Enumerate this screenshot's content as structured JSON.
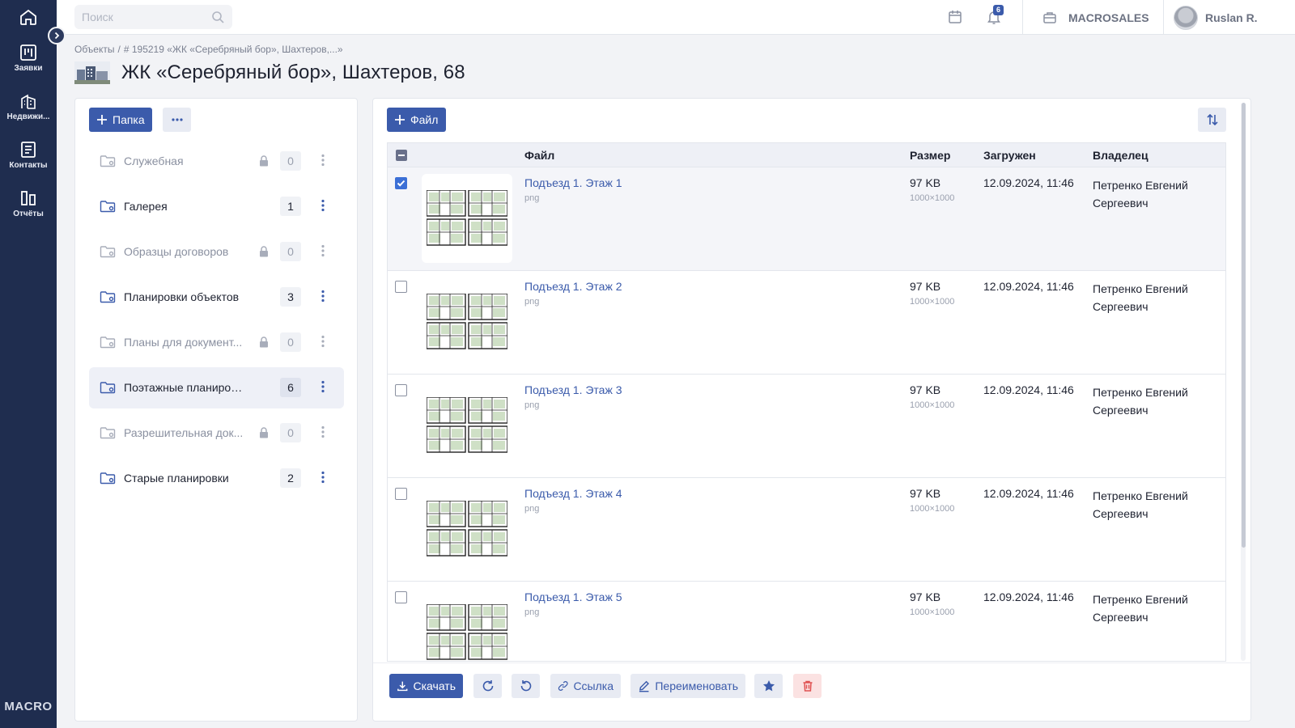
{
  "nav": {
    "items": [
      {
        "label": "Заявки",
        "icon": "kanban-icon"
      },
      {
        "label": "Недвижи...",
        "icon": "building-icon"
      },
      {
        "label": "Контакты",
        "icon": "contacts-icon"
      },
      {
        "label": "Отчёты",
        "icon": "reports-icon"
      }
    ],
    "brand": "MACRO"
  },
  "topbar": {
    "search_placeholder": "Поиск",
    "notifications_count": "6",
    "company": "MACROSALES",
    "user_name": "Ruslan R."
  },
  "breadcrumb": {
    "root": "Объекты",
    "separator": "/",
    "current": "# 195219 «ЖК «Серебряный бор», Шахтеров,...»"
  },
  "page": {
    "title": "ЖК «Серебряный бор», Шахтеров, 68"
  },
  "folders_panel": {
    "add_label": "Папка",
    "folders": [
      {
        "name": "Служебная",
        "count": "0",
        "locked": true,
        "muted": true,
        "active": false
      },
      {
        "name": "Галерея",
        "count": "1",
        "locked": false,
        "muted": false,
        "active": false
      },
      {
        "name": "Образцы договоров",
        "count": "0",
        "locked": true,
        "muted": true,
        "active": false
      },
      {
        "name": "Планировки объектов",
        "count": "3",
        "locked": false,
        "muted": false,
        "active": false
      },
      {
        "name": "Планы для документ...",
        "count": "0",
        "locked": true,
        "muted": true,
        "active": false
      },
      {
        "name": "Поэтажные планировки",
        "count": "6",
        "locked": false,
        "muted": false,
        "active": true
      },
      {
        "name": "Разрешительная док...",
        "count": "0",
        "locked": true,
        "muted": true,
        "active": false
      },
      {
        "name": "Старые планировки",
        "count": "2",
        "locked": false,
        "muted": false,
        "active": false
      }
    ]
  },
  "files_panel": {
    "add_label": "Файл",
    "columns": {
      "file": "Файл",
      "size": "Размер",
      "uploaded": "Загружен",
      "owner": "Владелец"
    },
    "files": [
      {
        "name": "Подъезд 1. Этаж 1",
        "type": "png",
        "size": "97 KB",
        "dims": "1000×1000",
        "date": "12.09.2024, 11:46",
        "owner": "Петренко Евгений Сергеевич",
        "checked": true
      },
      {
        "name": "Подъезд 1. Этаж 2",
        "type": "png",
        "size": "97 KB",
        "dims": "1000×1000",
        "date": "12.09.2024, 11:46",
        "owner": "Петренко Евгений Сергеевич",
        "checked": false
      },
      {
        "name": "Подъезд 1. Этаж 3",
        "type": "png",
        "size": "97 KB",
        "dims": "1000×1000",
        "date": "12.09.2024, 11:46",
        "owner": "Петренко Евгений Сергеевич",
        "checked": false
      },
      {
        "name": "Подъезд 1. Этаж 4",
        "type": "png",
        "size": "97 KB",
        "dims": "1000×1000",
        "date": "12.09.2024, 11:46",
        "owner": "Петренко Евгений Сергеевич",
        "checked": false
      },
      {
        "name": "Подъезд 1. Этаж 5",
        "type": "png",
        "size": "97 KB",
        "dims": "1000×1000",
        "date": "12.09.2024, 11:46",
        "owner": "Петренко Евгений Сергеевич",
        "checked": false
      }
    ]
  },
  "actions": {
    "download": "Скачать",
    "link": "Ссылка",
    "rename": "Переименовать"
  },
  "colors": {
    "nav_bg": "#1f2d4f",
    "accent": "#3b5bab",
    "danger": "#e05252"
  }
}
